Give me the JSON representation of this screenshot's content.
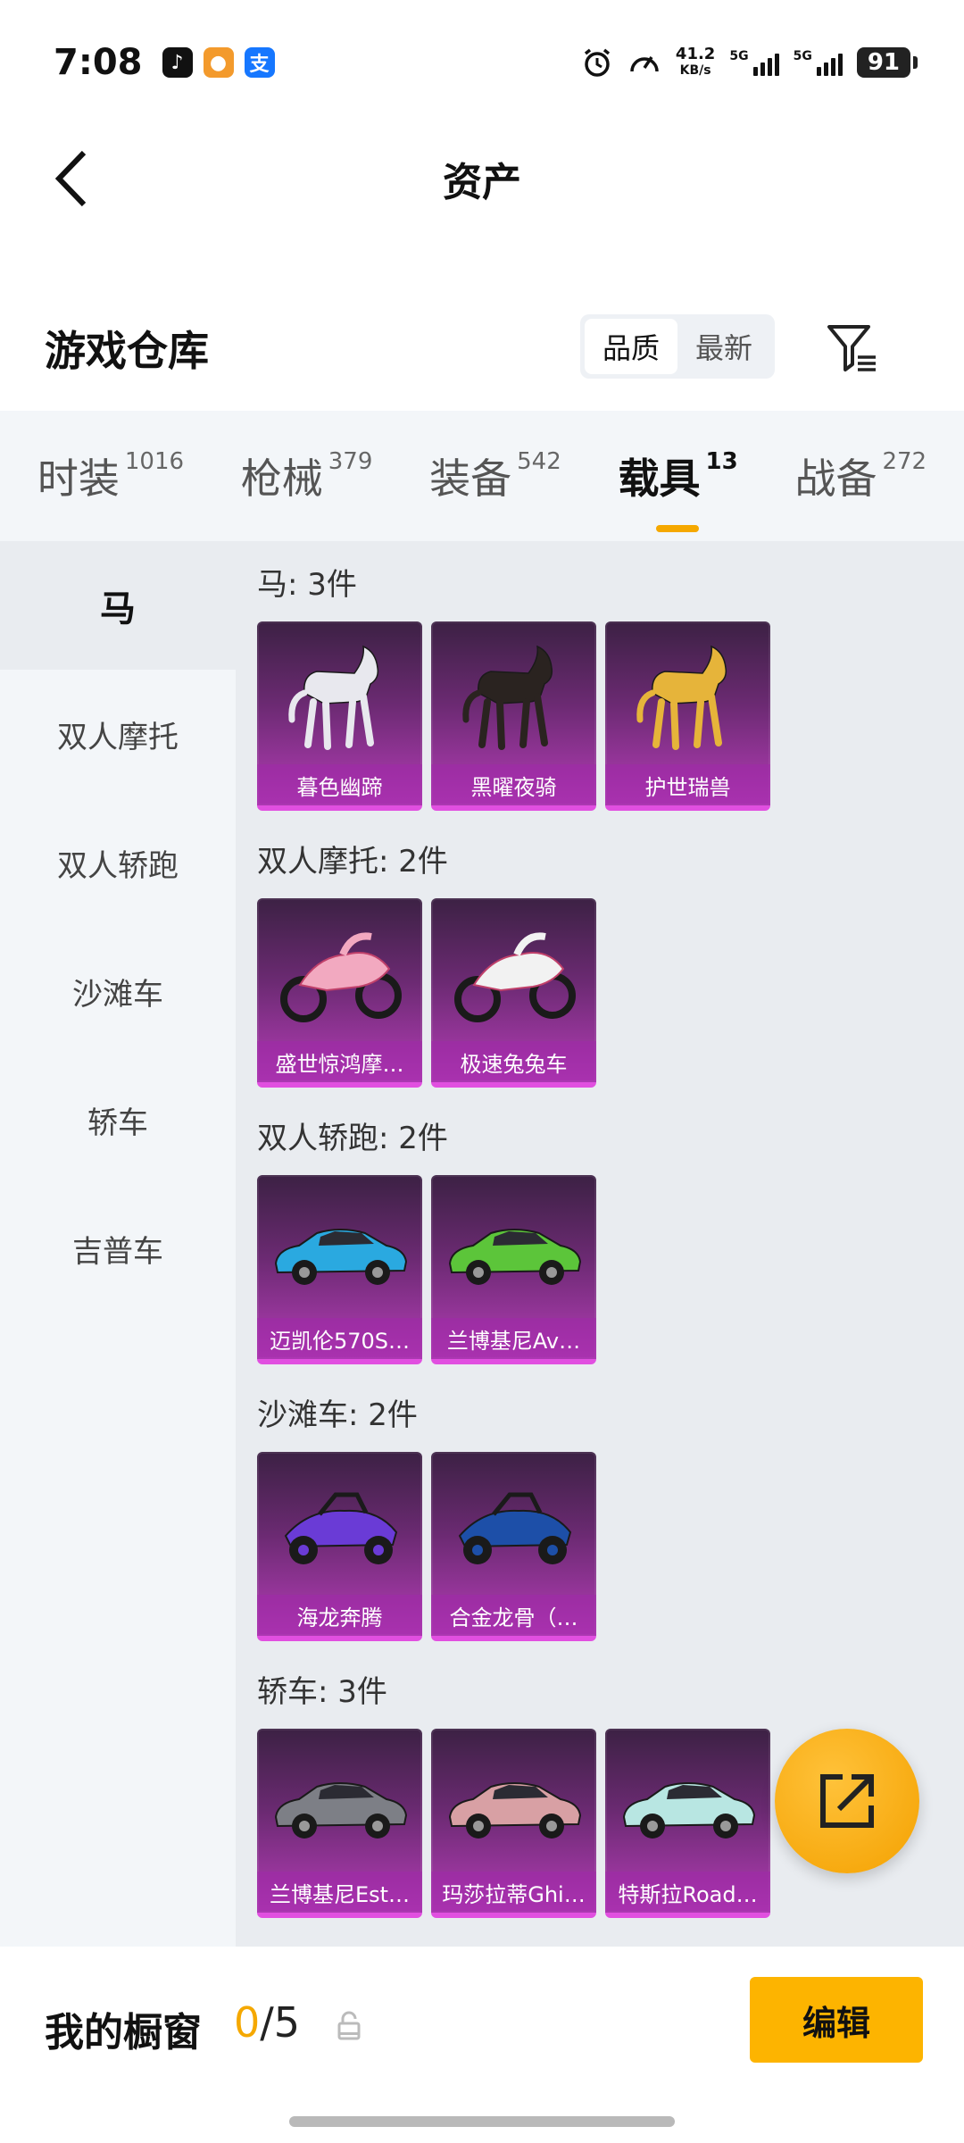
{
  "status": {
    "time": "7:08",
    "net_speed_value": "41.2",
    "net_speed_unit": "KB/s",
    "sim1": "5G",
    "sim2": "5G",
    "battery": "91",
    "apps": [
      {
        "icon": "tiktok-icon",
        "glyph": "♪",
        "color": "#111111"
      },
      {
        "icon": "app-badge-icon",
        "glyph": "●",
        "color": "#f39a2c"
      },
      {
        "icon": "alipay-icon",
        "glyph": "支",
        "color": "#1677ff"
      }
    ]
  },
  "header": {
    "title": "资产"
  },
  "section": {
    "title": "游戏仓库",
    "sort_options": [
      "品质",
      "最新"
    ],
    "active_sort": "品质"
  },
  "category_tabs": [
    {
      "name": "时装",
      "count": "1016",
      "active": false
    },
    {
      "name": "枪械",
      "count": "379",
      "active": false
    },
    {
      "name": "装备",
      "count": "542",
      "active": false
    },
    {
      "name": "载具",
      "count": "13",
      "active": true
    },
    {
      "name": "战备",
      "count": "272",
      "active": false
    }
  ],
  "sidebar": {
    "items": [
      "马",
      "双人摩托",
      "双人轿跑",
      "沙滩车",
      "轿车",
      "吉普车"
    ],
    "active": "马"
  },
  "groups": [
    {
      "title": "马: 3件",
      "items": [
        {
          "label": "暮色幽蹄",
          "art": "horse-white",
          "color": "#e8e8ee"
        },
        {
          "label": "黑曜夜骑",
          "art": "horse-black",
          "color": "#2a2320"
        },
        {
          "label": "护世瑞兽",
          "art": "horse-gold",
          "color": "#e6b43a"
        }
      ]
    },
    {
      "title": "双人摩托: 2件",
      "items": [
        {
          "label": "盛世惊鸿摩…",
          "art": "moto-pink",
          "color": "#f2a9c0"
        },
        {
          "label": "极速兔兔车",
          "art": "moto-white",
          "color": "#f2f2f2"
        }
      ]
    },
    {
      "title": "双人轿跑: 2件",
      "items": [
        {
          "label": "迈凯伦570S…",
          "art": "car-blue",
          "color": "#2aa9e0"
        },
        {
          "label": "兰博基尼Av…",
          "art": "car-green",
          "color": "#5cc53a"
        }
      ]
    },
    {
      "title": "沙滩车: 2件",
      "items": [
        {
          "label": "海龙奔腾",
          "art": "buggy-purple",
          "color": "#6a3bd6"
        },
        {
          "label": "合金龙骨（…",
          "art": "buggy-blue",
          "color": "#1d4fa8"
        }
      ]
    },
    {
      "title": "轿车: 3件",
      "items": [
        {
          "label": "兰博基尼Est…",
          "art": "car-grey",
          "color": "#7d7f86"
        },
        {
          "label": "玛莎拉蒂Ghi…",
          "art": "car-rose",
          "color": "#d8a0a4"
        },
        {
          "label": "特斯拉Road…",
          "art": "car-mint",
          "color": "#b8e6e2"
        }
      ]
    }
  ],
  "bottom": {
    "showcase_label": "我的橱窗",
    "showcase_used": "0",
    "showcase_total": "/5",
    "edit_label": "编辑"
  },
  "colors": {
    "accent": "#f5a800",
    "card_gradient_top": "#3c2144",
    "card_gradient_bottom": "#b43db6"
  }
}
